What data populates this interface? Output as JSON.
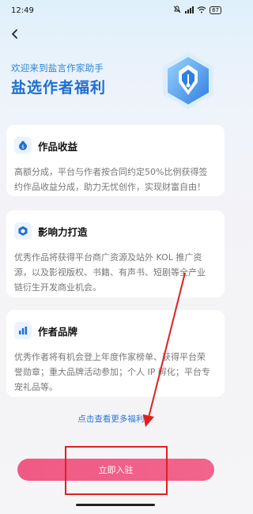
{
  "status_bar": {
    "time": "12:49",
    "battery": "67"
  },
  "header": {
    "back_icon": "chevron-left-icon"
  },
  "hero": {
    "subtitle": "欢迎来到盐言作家助手",
    "title": "盐选作者福利",
    "badge_icon": "pen-nib-hexagon-icon"
  },
  "cards": [
    {
      "icon": "money-bag-icon",
      "title": "作品收益",
      "body": "高额分成，平台与作者按合同约定50%比例获得签约作品收益分成，助力无忧创作，实现财富自由！"
    },
    {
      "icon": "hexagon-badge-icon",
      "title": "影响力打造",
      "body": "优秀作品将获得平台商广资源及站外 KOL 推广资源，以及影视版权、书籍、有声书、短剧等全产业链衍生开发商业机会。"
    },
    {
      "icon": "bar-chart-icon",
      "title": "作者品牌",
      "body": "优秀作者将有机会登上年度作家榜单、获得平台荣誉勋章；重大品牌活动参加；个人 IP 孵化；平台专宠礼品等。"
    }
  ],
  "more_link": "点击查看更多福利",
  "more_link_icon": "chevron-right-icon",
  "cta_label": "立即入驻",
  "colors": {
    "accent_blue": "#1f6fd0",
    "cta_pink": "#f0577f",
    "annotation_red": "#e02020"
  }
}
